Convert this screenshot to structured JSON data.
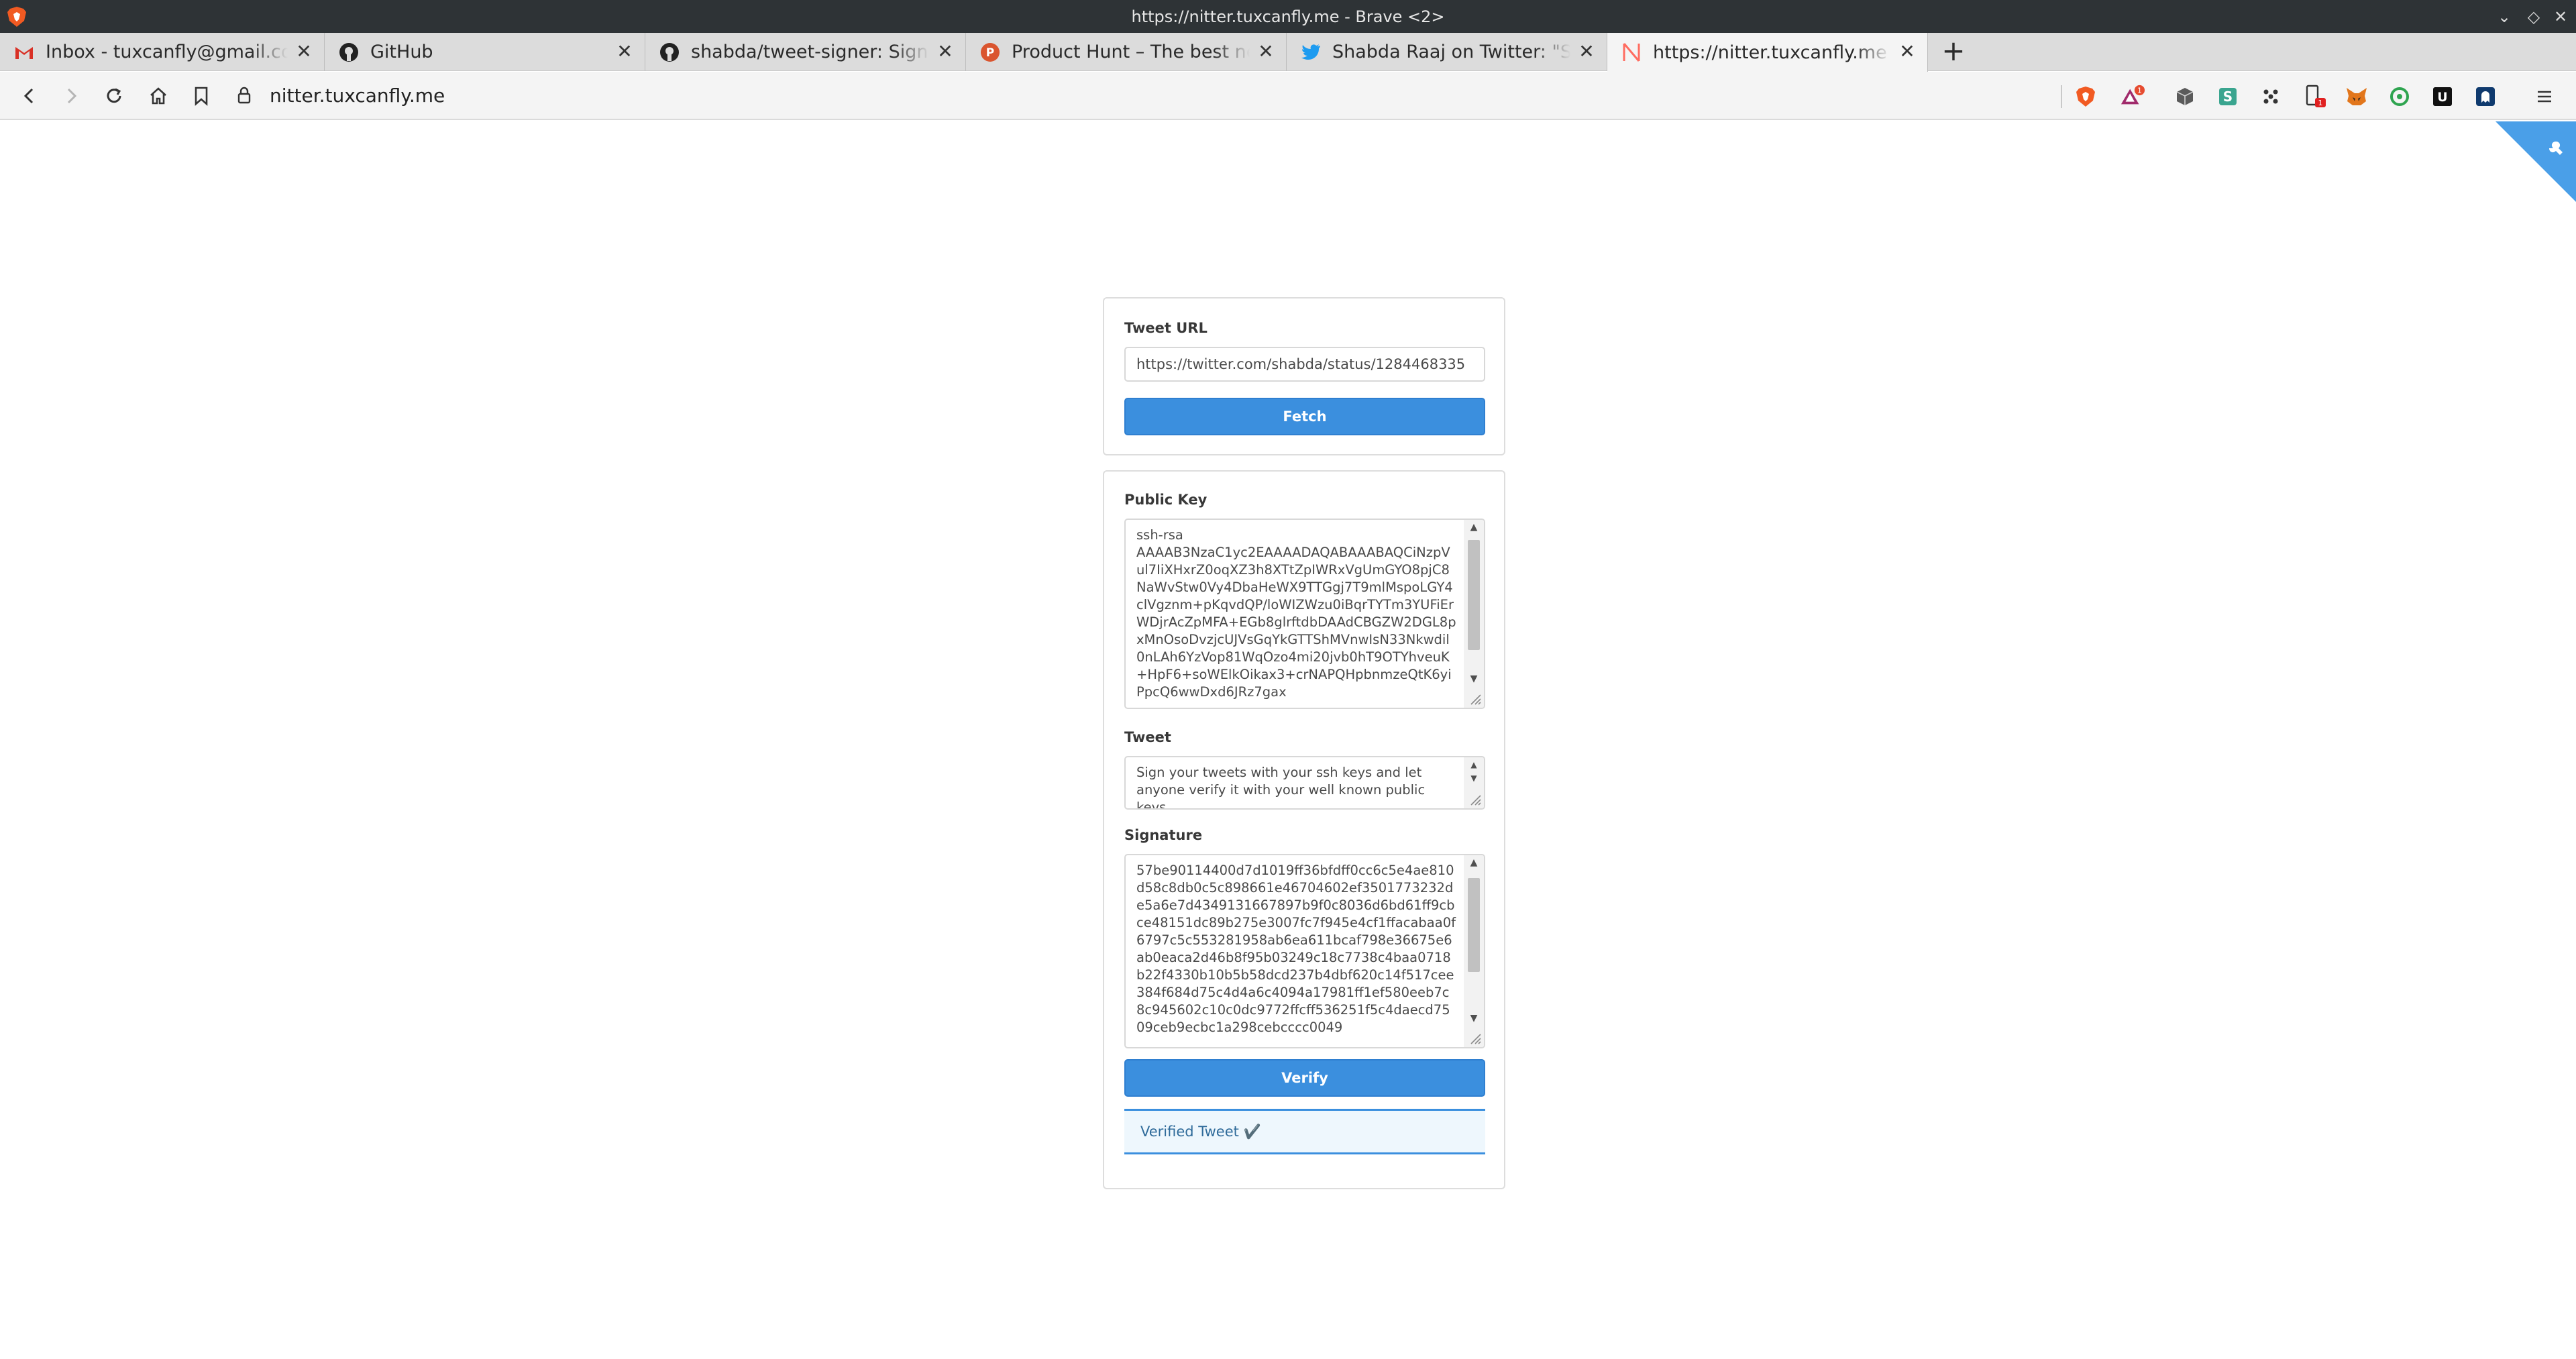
{
  "window": {
    "title": "https://nitter.tuxcanfly.me - Brave <2>"
  },
  "tabs": [
    {
      "label": "Inbox - tuxcanfly@gmail.com - Gmail",
      "favicon": "gmail-icon"
    },
    {
      "label": "GitHub",
      "favicon": "github-icon"
    },
    {
      "label": "shabda/tweet-signer: Sign your tweets",
      "favicon": "github-icon"
    },
    {
      "label": "Product Hunt – The best new products",
      "favicon": "product-hunt-icon"
    },
    {
      "label": "Shabda Raaj on Twitter: \"Sign your tweets",
      "favicon": "twitter-icon"
    },
    {
      "label": "https://nitter.tuxcanfly.me",
      "favicon": "nitter-icon",
      "active": true
    }
  ],
  "toolbar": {
    "url": "nitter.tuxcanfly.me",
    "extensions": [
      "brave-shields-icon",
      "brave-rewards-icon",
      "cube-extension-icon",
      "s-extension-icon",
      "dots-extension-icon",
      "mobile-extension-icon",
      "metamask-fox-icon",
      "circle-extension-icon",
      "u-extension-icon",
      "ghost-extension-icon"
    ],
    "rewards_badge": "1",
    "mobile_badge": "1"
  },
  "colors": {
    "accent": "#3b8fde",
    "success_bg": "#eef7fd"
  },
  "form": {
    "tweet_url_label": "Tweet URL",
    "tweet_url_value": "https://twitter.com/shabda/status/1284468335",
    "fetch_label": "Fetch",
    "public_key_label": "Public Key",
    "public_key_value": "ssh-rsa\nAAAAB3NzaC1yc2EAAAADAQABAAABAQCiNzpVul7IiXHxrZ0oqXZ3h8XTtZpIWRxVgUmGYO8pjC8NaWvStw0Vy4DbaHeWX9TTGgj7T9mlMspoLGY4clVgznm+pKqvdQP/loWIZWzu0iBqrTYTm3YUFiErWDjrAcZpMFA+EGb8glrftdbDAAdCBGZW2DGL8pxMnOsoDvzjcUJVsGqYkGTTShMVnwIsN33Nkwdil0nLAh6YzVop81WqOzo4mi20jvb0hT9OTYhveuK+HpF6+soWElkOikax3+crNAPQHpbnmzeQtK6yiPpcQ6wwDxd6JRz7gax",
    "tweet_label": "Tweet",
    "tweet_value": "Sign your tweets with your ssh keys and let anyone verify it with your well known public keys",
    "signature_label": "Signature",
    "signature_value": "57be90114400d7d1019ff36bfdff0cc6c5e4ae810d58c8db0c5c898661e46704602ef3501773232de5a6e7d4349131667897b9f0c8036d6bd61ff9cbce48151dc89b275e3007fc7f945e4cf1ffacabaa0f6797c5c553281958ab6ea611bcaf798e36675e6ab0eaca2d46b8f95b03249c18c7738c4baa0718b22f4330b10b5b58dcd237b4dbf620c14f517cee384f684d75c4d4a6c4094a17981ff1ef580eeb7c8c945602c10c0dc9772ffcff536251f5c4daecd7509ceb9ecbc1a298cebcccc0049",
    "verify_label": "Verify",
    "result_text": "Verified Tweet ✔️"
  }
}
